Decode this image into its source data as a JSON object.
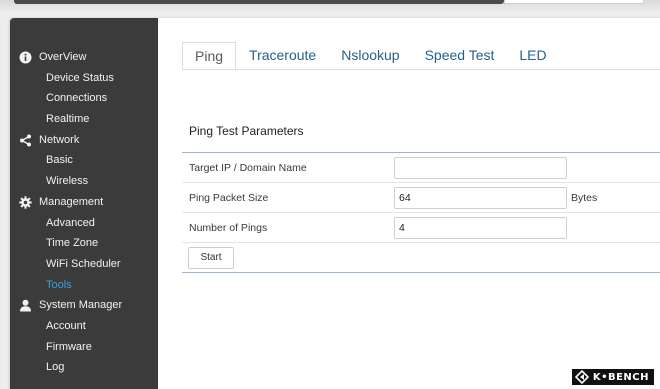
{
  "sidebar": {
    "sections": [
      {
        "label": "OverView",
        "icon": "info-icon",
        "items": [
          "Device Status",
          "Connections",
          "Realtime"
        ]
      },
      {
        "label": "Network",
        "icon": "share-icon",
        "items": [
          "Basic",
          "Wireless"
        ]
      },
      {
        "label": "Management",
        "icon": "gear-icon",
        "items": [
          "Advanced",
          "Time Zone",
          "WiFi Scheduler",
          "Tools"
        ]
      },
      {
        "label": "System Manager",
        "icon": "user-icon",
        "items": [
          "Account",
          "Firmware",
          "Log"
        ]
      }
    ],
    "active_item": "Tools"
  },
  "tabs": [
    "Ping",
    "Traceroute",
    "Nslookup",
    "Speed Test",
    "LED"
  ],
  "active_tab": "Ping",
  "section_title": "Ping Test Parameters",
  "form": {
    "target_label": "Target IP / Domain Name",
    "target_value": "",
    "packet_label": "Ping Packet Size",
    "packet_value": "64",
    "packet_unit": "Bytes",
    "count_label": "Number of Pings",
    "count_value": "4",
    "start_button": "Start"
  },
  "watermark": "K•BENCH",
  "colors": {
    "sidebar_bg": "#3b3b3b",
    "active_link": "#3aa0d8",
    "tab_text": "#2a5f8a",
    "table_border": "#9bb5cf"
  }
}
